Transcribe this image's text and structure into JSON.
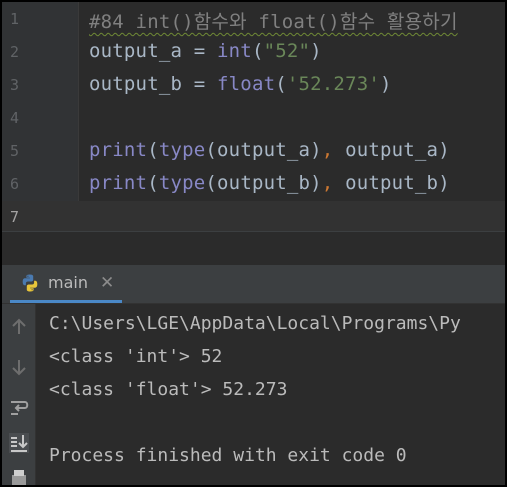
{
  "editor": {
    "lines": [
      {
        "number": "1",
        "tokens": [
          {
            "t": "#84 int()함수와 float()함수 활용하기",
            "c": "comment"
          }
        ]
      },
      {
        "number": "2",
        "tokens": [
          {
            "t": "output_a = ",
            "c": "plain"
          },
          {
            "t": "int",
            "c": "builtin"
          },
          {
            "t": "(",
            "c": "plain"
          },
          {
            "t": "\"52\"",
            "c": "string"
          },
          {
            "t": ")",
            "c": "plain"
          }
        ]
      },
      {
        "number": "3",
        "tokens": [
          {
            "t": "output_b = ",
            "c": "plain"
          },
          {
            "t": "float",
            "c": "builtin"
          },
          {
            "t": "(",
            "c": "plain"
          },
          {
            "t": "'52.273'",
            "c": "string"
          },
          {
            "t": ")",
            "c": "plain"
          }
        ]
      },
      {
        "number": "4",
        "tokens": []
      },
      {
        "number": "5",
        "tokens": [
          {
            "t": "print",
            "c": "builtin"
          },
          {
            "t": "(",
            "c": "plain"
          },
          {
            "t": "type",
            "c": "builtin"
          },
          {
            "t": "(output_a)",
            "c": "plain"
          },
          {
            "t": ",",
            "c": "kw"
          },
          {
            "t": " output_a)",
            "c": "plain"
          }
        ]
      },
      {
        "number": "6",
        "tokens": [
          {
            "t": "print",
            "c": "builtin"
          },
          {
            "t": "(",
            "c": "plain"
          },
          {
            "t": "type",
            "c": "builtin"
          },
          {
            "t": "(output_b)",
            "c": "plain"
          },
          {
            "t": ",",
            "c": "kw"
          },
          {
            "t": " output_b)",
            "c": "plain"
          }
        ]
      },
      {
        "number": "7",
        "tokens": [],
        "current": true
      }
    ]
  },
  "run": {
    "tab_label": "main",
    "tab_icon": "python-icon",
    "toolbar_icons": [
      "rerun-up-icon",
      "down-arrow-icon",
      "soft-wrap-icon",
      "scroll-to-end-icon",
      "print-icon"
    ],
    "output": [
      "C:\\Users\\LGE\\AppData\\Local\\Programs\\Py",
      "<class 'int'> 52",
      "<class 'float'> 52.273",
      "",
      "Process finished with exit code 0"
    ]
  },
  "colors": {
    "background": "#2b2b2b",
    "gutter": "#313335",
    "comment": "#808080",
    "builtin": "#8888c6",
    "string": "#6a8759",
    "plain": "#a9b7c6",
    "keyword": "#cc7832",
    "tab_accent": "#4a88c7"
  }
}
